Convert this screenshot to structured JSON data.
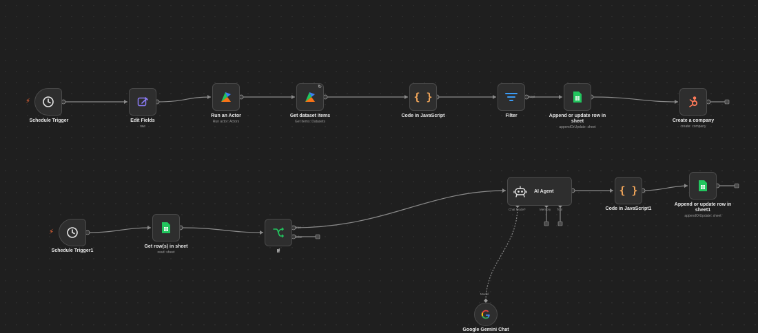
{
  "colors": {
    "background": "#1f1f1f",
    "node_bg": "#2e2e2e",
    "wire": "#8a8a8a",
    "accent_trigger": "#ff6d3a"
  },
  "row1": {
    "schedule_trigger": {
      "label": "Schedule Trigger"
    },
    "edit_fields": {
      "label": "Edit Fields",
      "sub": "raw"
    },
    "run_actor": {
      "label": "Run an Actor",
      "sub": "Run actor: Actors"
    },
    "get_dataset": {
      "label": "Get dataset items",
      "sub": "Get items: Datasets"
    },
    "code_js": {
      "label": "Code in JavaScript"
    },
    "filter": {
      "label": "Filter",
      "port_kept": "Kept"
    },
    "append_sheet": {
      "label_line1": "Append or update row in",
      "label_line2": "sheet",
      "sub": "appendOrUpdate: sheet"
    },
    "create_company": {
      "label": "Create a company",
      "sub": "create: company"
    }
  },
  "row2": {
    "schedule_trigger1": {
      "label": "Schedule Trigger1"
    },
    "get_rows": {
      "label": "Get row(s) in sheet",
      "sub": "read: sheet"
    },
    "if_node": {
      "label": "If",
      "port_true": "true",
      "port_false": "false"
    },
    "ai_agent": {
      "label": "AI Agent",
      "port_chat_model": "Chat Model*",
      "port_memory": "Memory",
      "port_tool": "Tool"
    },
    "code_js1": {
      "label": "Code in JavaScript1"
    },
    "append_sheet1": {
      "label_line1": "Append or update row in",
      "label_line2": "sheet1",
      "sub": "appendOrUpdate: sheet"
    },
    "gemini": {
      "label": "Google Gemini Chat",
      "port_model": "Model"
    }
  },
  "icons": [
    "clock-icon",
    "pencil-icon",
    "apify-icon",
    "refresh-icon",
    "code-braces-icon",
    "filter-icon",
    "google-sheets-icon",
    "hubspot-icon",
    "if-branch-icon",
    "robot-icon",
    "google-icon",
    "lightning-icon"
  ]
}
